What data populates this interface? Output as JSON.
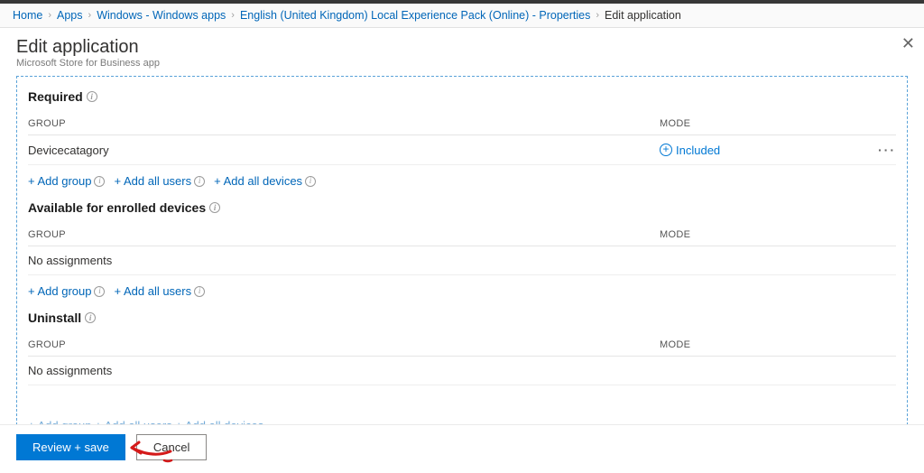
{
  "breadcrumbs": [
    {
      "label": "Home",
      "link": true
    },
    {
      "label": "Apps",
      "link": true
    },
    {
      "label": "Windows - Windows apps",
      "link": true
    },
    {
      "label": "English (United Kingdom) Local Experience Pack (Online) - Properties",
      "link": true
    },
    {
      "label": "Edit application",
      "link": false
    }
  ],
  "panel": {
    "title": "Edit application",
    "subtitle": "Microsoft Store for Business app"
  },
  "columns": {
    "group": "GROUP",
    "mode": "MODE"
  },
  "sections": {
    "required": {
      "title": "Required",
      "rows": [
        {
          "group": "Devicecatagory",
          "mode": "Included"
        }
      ],
      "empty": "",
      "actions": {
        "addGroup": "+ Add group",
        "addAllUsers": "+ Add all users",
        "addAllDevices": "+ Add all devices"
      }
    },
    "available": {
      "title": "Available for enrolled devices",
      "empty": "No assignments",
      "actions": {
        "addGroup": "+ Add group",
        "addAllUsers": "+ Add all users"
      }
    },
    "uninstall": {
      "title": "Uninstall",
      "empty": "No assignments",
      "cutoff": "+ Add group    + Add all users    + Add all devices"
    }
  },
  "footer": {
    "primary": "Review + save",
    "secondary": "Cancel"
  }
}
